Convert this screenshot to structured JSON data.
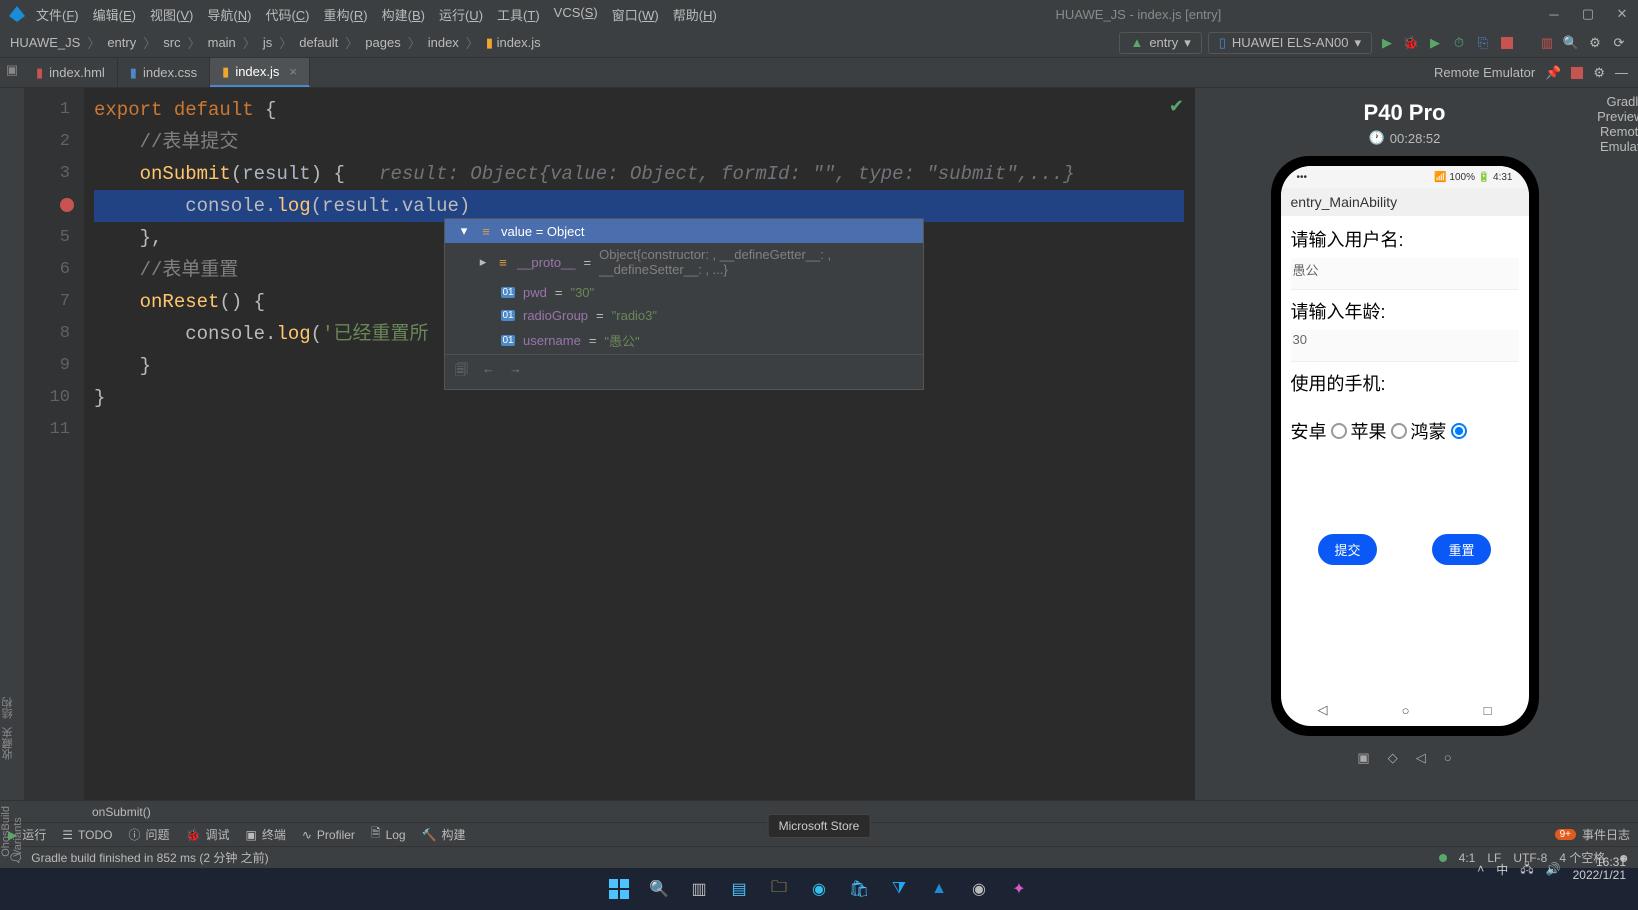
{
  "window": {
    "title": "HUAWE_JS - index.js [entry]"
  },
  "menus": [
    {
      "label": "文件",
      "key": "F"
    },
    {
      "label": "编辑",
      "key": "E"
    },
    {
      "label": "视图",
      "key": "V"
    },
    {
      "label": "导航",
      "key": "N"
    },
    {
      "label": "代码",
      "key": "C"
    },
    {
      "label": "重构",
      "key": "R"
    },
    {
      "label": "构建",
      "key": "B"
    },
    {
      "label": "运行",
      "key": "U"
    },
    {
      "label": "工具",
      "key": "T"
    },
    {
      "label": "VCS",
      "key": "S"
    },
    {
      "label": "窗口",
      "key": "W"
    },
    {
      "label": "帮助",
      "key": "H"
    }
  ],
  "breadcrumbs": [
    "HUAWE_JS",
    "entry",
    "src",
    "main",
    "js",
    "default",
    "pages",
    "index",
    "index.js"
  ],
  "run_config": {
    "module": "entry",
    "device": "HUAWEI ELS-AN00"
  },
  "tabs": [
    {
      "name": "index.hml",
      "kind": "hml",
      "active": false
    },
    {
      "name": "index.css",
      "kind": "css",
      "active": false
    },
    {
      "name": "index.js",
      "kind": "js",
      "active": true
    }
  ],
  "emulator_panel": {
    "title": "Remote Emulator"
  },
  "code": {
    "lines": [
      {
        "n": 1,
        "html": "<span class='kw'>export default </span>{"
      },
      {
        "n": 2,
        "html": "    <span class='com'>//表单提交</span>"
      },
      {
        "n": 3,
        "html": "    <span class='fn'>onSubmit</span>(<span class='param'>result</span>) {   <span class='hint'>result: Object{value: Object, formId: \"\", type: \"submit\",...}</span>"
      },
      {
        "n": 4,
        "hi": true,
        "bp": true,
        "html": "        console.<span class='fn'>log</span>(result.value)"
      },
      {
        "n": 5,
        "html": "    },"
      },
      {
        "n": 6,
        "html": "    <span class='com'>//表单重置</span>"
      },
      {
        "n": 7,
        "html": "    <span class='fn'>onReset</span>() {"
      },
      {
        "n": 8,
        "html": "        console.<span class='fn'>log</span>(<span class='str'>'已经重置所</span>"
      },
      {
        "n": 9,
        "html": "    }"
      },
      {
        "n": 10,
        "html": "}"
      },
      {
        "n": 11,
        "html": ""
      }
    ],
    "context": "onSubmit()"
  },
  "debug": {
    "header": "value = Object",
    "rows": [
      {
        "key": "__proto__",
        "eq": " = ",
        "val": "Object{constructor: , __defineGetter__: , __defineSetter__: , ...}",
        "obj": true,
        "chev": true
      },
      {
        "key": "pwd",
        "eq": " = ",
        "val": "\"30\""
      },
      {
        "key": "radioGroup",
        "eq": " = ",
        "val": "\"radio3\""
      },
      {
        "key": "username",
        "eq": " = ",
        "val": "\"愚公\""
      }
    ]
  },
  "emulator": {
    "device": "P40 Pro",
    "elapsed": "00:28:52",
    "status_time": "4:31",
    "app_title": "entry_MainAbility",
    "label_user": "请输入用户名:",
    "input_user": "愚公",
    "label_age": "请输入年龄:",
    "input_age": "30",
    "label_phone": "使用的手机:",
    "radios": [
      {
        "label": "安卓",
        "on": false
      },
      {
        "label": "苹果",
        "on": false
      },
      {
        "label": "鸿蒙",
        "on": true
      }
    ],
    "btn_submit": "提交",
    "btn_reset": "重置"
  },
  "bottom_tools": {
    "run": "运行",
    "todo": "TODO",
    "problems": "问题",
    "debug": "调试",
    "terminal": "终端",
    "profiler": "Profiler",
    "log": "Log",
    "build": "构建",
    "events": "事件日志",
    "events_badge": "9+"
  },
  "build_status": "Gradle build finished in 852 ms (2 分钟 之前)",
  "statusbar": {
    "pos": "4:1",
    "lf": "LF",
    "enc": "UTF-8",
    "indent": "4 个空格"
  },
  "taskbar": {
    "tooltip": "Microsoft Store",
    "ime": "中",
    "clock": "16:31",
    "date": "2022/1/21"
  },
  "side_right": {
    "gradle": "Gradle",
    "previewer": "Previewer",
    "remote": "Remote Emulator"
  },
  "side_left": {
    "structure": "结构",
    "fav": "收藏夹",
    "variants": "OhosBuild Variants"
  }
}
